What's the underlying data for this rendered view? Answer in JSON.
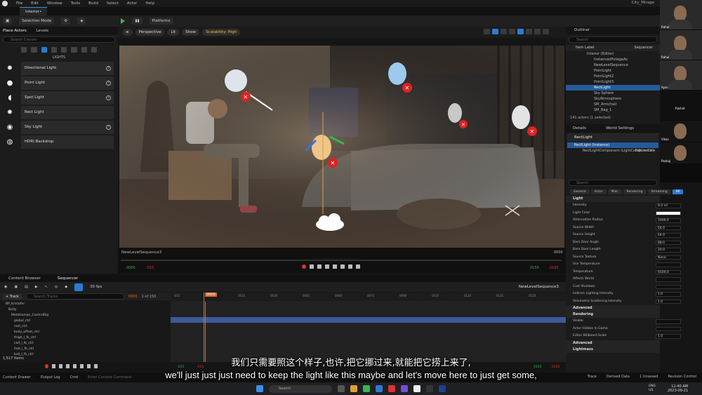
{
  "menu": {
    "items": [
      "File",
      "Edit",
      "Window",
      "Tools",
      "Build",
      "Select",
      "Actor",
      "Help"
    ],
    "project": "City_Mirage"
  },
  "doc_tab": "Interior•",
  "toolbar": {
    "mode": "Selection Mode",
    "platforms": "Platforms"
  },
  "left_panel": {
    "tabs": [
      "Place Actors",
      "Levels"
    ],
    "search_placeholder": "Search Classes",
    "category": "LIGHTS",
    "actors": [
      "Directional Light",
      "Point Light",
      "Spot Light",
      "Rect Light",
      "Sky Light",
      "HDRI Backdrop"
    ]
  },
  "viewport": {
    "perspective": "Perspective",
    "lit": "Lit",
    "show": "Show",
    "scalability": "Scalability: High",
    "fov": "10°",
    "speed": "0.25",
    "snap": "0.03"
  },
  "seq_bar": {
    "name": "NewLevelSequence3",
    "end": "0000",
    "start_green": "0000",
    "start_red": "-015",
    "end_green": "0150",
    "end_red": "0165"
  },
  "outliner": {
    "tab": "Outliner",
    "search": "Search",
    "headers": [
      "Item Label",
      "Sequencer"
    ],
    "rows": [
      "Interior (Editor)",
      "InstancedFoliageAc",
      "NewLevelSequence",
      "PointLight",
      "PointLight2",
      "PointLight3",
      "RectLight",
      "Sky Sphere",
      "SkyAtmosphere",
      "SM_Armchair",
      "SM_Bag_1"
    ],
    "selected": "RectLight",
    "count": "141 actors (1 selected)"
  },
  "details": {
    "tabs": [
      "Details",
      "World Settings"
    ],
    "name": "RectLight",
    "instance": "RectLight (Instance)",
    "component": "RectLightComponent (LightComponent0)",
    "edit": "Edit in C++",
    "search": "Search",
    "filters": [
      "General",
      "Actor",
      "Misc",
      "Rendering",
      "Streaming",
      "All"
    ],
    "sections": {
      "light": "Light",
      "light_props": [
        {
          "label": "Intensity",
          "value": "8.0 cd"
        },
        {
          "label": "Light Color",
          "value": ""
        },
        {
          "label": "Attenuation Radius",
          "value": "1000.0"
        },
        {
          "label": "Source Width",
          "value": "64.0"
        },
        {
          "label": "Source Height",
          "value": "64.0"
        },
        {
          "label": "Barn Door Angle",
          "value": "88.0"
        },
        {
          "label": "Barn Door Length",
          "value": "20.0"
        },
        {
          "label": "Source Texture",
          "value": "None"
        },
        {
          "label": "Use Temperature",
          "value": ""
        },
        {
          "label": "Temperature",
          "value": "6500.0"
        },
        {
          "label": "Affects World",
          "value": ""
        },
        {
          "label": "Cast Shadows",
          "value": ""
        },
        {
          "label": "Indirect Lighting Intensity",
          "value": "1.0"
        },
        {
          "label": "Volumetric Scattering Intensity",
          "value": "1.0"
        }
      ],
      "advanced": "Advanced",
      "rendering": "Rendering",
      "rendering_props": [
        {
          "label": "Visible",
          "value": ""
        },
        {
          "label": "Actor Hidden In Game",
          "value": ""
        },
        {
          "label": "Editor Billboard Scale",
          "value": "1.0"
        }
      ],
      "advanced2": "Advanced",
      "lightmass": "Lightmass"
    }
  },
  "sequencer": {
    "tabs": [
      "Content Browser",
      "Sequencer"
    ],
    "fps": "30 fps",
    "title": "NewLevelSequence3",
    "add_track": "+ Track",
    "search": "Search Tracks",
    "frame": "0000",
    "of": "1 of 150",
    "tracks": [
      "BP_Kristofer",
      "Body",
      "MetaHuman_ControlRig",
      "global_ctrl",
      "root_ctrl",
      "body_offset_ctrl",
      "thigh_l_fk_ctrl",
      "calf_l_fk_ctrl",
      "foot_l_fk_ctrl",
      "ball_l_fk_ctrl"
    ],
    "ruler": [
      "-015",
      "0000",
      "0015",
      "0030",
      "0045",
      "0060",
      "0075",
      "0090",
      "0105",
      "0120",
      "0135",
      "0150"
    ],
    "items": "1,517 items",
    "bottom_left": "-015",
    "bottom_left2": "-015",
    "bottom_right": "0165",
    "bottom_right2": "0165"
  },
  "statusbar": {
    "items": [
      "Content Drawer",
      "Output Log",
      "Cmd"
    ],
    "cmd_placeholder": "Enter Console Command",
    "right": [
      "Trace",
      "Derived Data",
      "1 Unsaved",
      "Revision Control"
    ]
  },
  "taskbar": {
    "search": "Search",
    "lang": "ENG\nUS",
    "time": "11:40 AM",
    "date": "2023-09-21"
  },
  "subtitles": {
    "cn": "我们只需要照这个样子,也许,把它挪过来,就能把它捞上来了,",
    "en": "we'll just just just need to keep the light like this maybe and let's move here to just get some,"
  },
  "video": {
    "names": [
      "Rahul",
      "Rahul",
      "Ayan",
      "Rashid",
      "Vikas",
      "Pankaj"
    ]
  }
}
